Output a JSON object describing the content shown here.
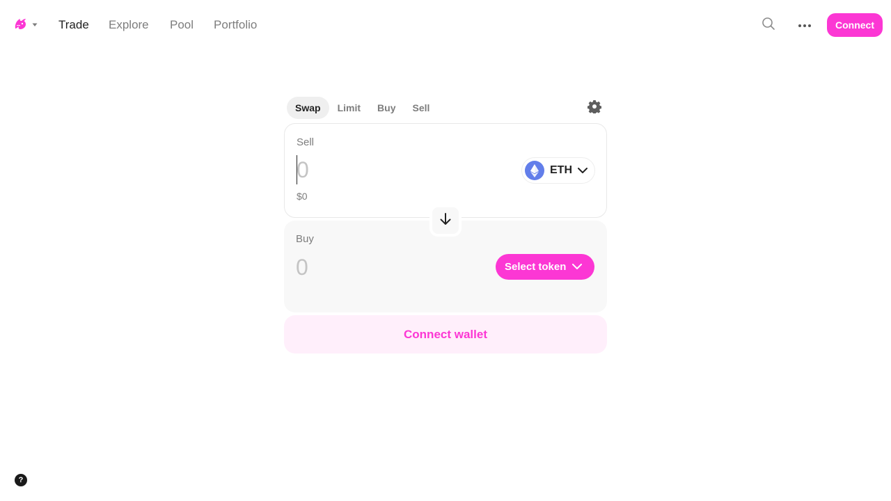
{
  "nav": {
    "logo_icon": "uniswap-unicorn-icon",
    "links": [
      {
        "label": "Trade",
        "active": true
      },
      {
        "label": "Explore",
        "active": false
      },
      {
        "label": "Pool",
        "active": false
      },
      {
        "label": "Portfolio",
        "active": false
      }
    ],
    "search_icon": "search-icon",
    "more_icon": "more-horizontal-icon",
    "connect_label": "Connect"
  },
  "swap": {
    "tabs": [
      {
        "label": "Swap",
        "active": true
      },
      {
        "label": "Limit",
        "active": false
      },
      {
        "label": "Buy",
        "active": false
      },
      {
        "label": "Sell",
        "active": false
      }
    ],
    "settings_icon": "gear-icon",
    "sell": {
      "label": "Sell",
      "amount": "0",
      "usd_value": "$0",
      "token": "ETH",
      "token_icon": "ethereum-icon"
    },
    "switch_icon": "arrow-down-icon",
    "buy": {
      "label": "Buy",
      "amount": "0",
      "select_token_label": "Select token"
    },
    "connect_wallet_label": "Connect wallet"
  },
  "help": {
    "label": "?"
  },
  "colors": {
    "accent": "#fc37d4",
    "accent_light": "#ffeffb",
    "eth_blue": "#627eea",
    "text_primary": "#222222",
    "text_secondary": "#7d7d7d"
  }
}
